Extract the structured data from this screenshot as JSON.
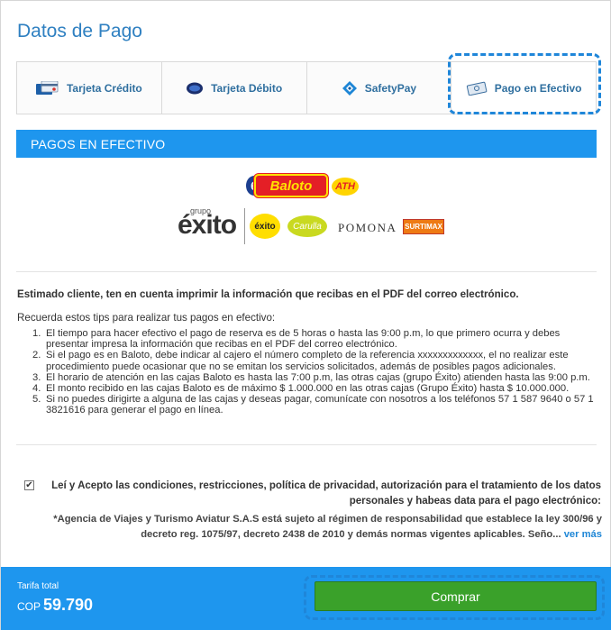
{
  "page": {
    "title": "Datos de Pago"
  },
  "tabs": [
    {
      "label": "Tarjeta Crédito",
      "icon": "credit-card-icon"
    },
    {
      "label": "Tarjeta Débito",
      "icon": "debit-card-icon"
    },
    {
      "label": "SafetyPay",
      "icon": "safetypay-icon"
    },
    {
      "label": "Pago en Efectivo",
      "icon": "cash-icon",
      "active": true
    }
  ],
  "section": {
    "heading": "PAGOS EN EFECTIVO"
  },
  "logos": {
    "baloto": "Baloto",
    "baloto_six": "6",
    "ath": "ATH",
    "grupo": "grupo",
    "exito": "éxito",
    "exito_badge": "éxito",
    "carulla": "Carulla",
    "pomona": "POMONA",
    "surtimax": "SURTIMAX"
  },
  "notice": "Estimado cliente, ten en cuenta imprimir la información que recibas en el PDF del correo electrónico.",
  "tips_intro": "Recuerda estos tips para realizar tus pagos en efectivo:",
  "tips": [
    {
      "num": "1.",
      "text": "El tiempo para hacer efectivo el pago de reserva es de 5 horas o hasta las 9:00 p.m, lo que primero ocurra y debes presentar impresa la información que recibas en el PDF del correo electrónico."
    },
    {
      "num": "2.",
      "text": "Si el pago es en Baloto, debe indicar al cajero el número completo de la referencia xxxxxxxxxxxxx, el no realizar este procedimiento puede ocasionar que no se emitan los servicios solicitados, además de posibles pagos adicionales."
    },
    {
      "num": "3.",
      "text": "El horario de atención en las cajas Baloto es hasta las 7:00 p.m, las otras cajas (grupo Éxito) atienden hasta las 9:00 p.m."
    },
    {
      "num": "4.",
      "text": "El monto recibido en las cajas Baloto es de máximo $ 1.000.000 en las otras cajas (Grupo Éxito) hasta $ 10.000.000."
    },
    {
      "num": "5.",
      "text": "Si no puedes dirigirte a alguna de las cajas y deseas pagar, comunícate con nosotros a los teléfonos 57 1 587 9640 o 57 1 3821616 para generar el pago en línea."
    }
  ],
  "terms": {
    "checked": true,
    "check_mark": "✔",
    "text": "Leí y Acepto las condiciones, restricciones, política de privacidad, autorización para el tratamiento de los datos personales y habeas data para el pago electrónico:"
  },
  "legal": {
    "text": "*Agencia de Viajes y Turismo Aviatur S.A.S está sujeto al régimen de responsabilidad que establece la ley 300/96 y decreto reg. 1075/97, decreto 2438 de 2010 y demás normas vigentes aplicables. Seño...",
    "more": "ver más"
  },
  "footer": {
    "tarifa_label": "Tarifa total",
    "currency": "COP",
    "amount": "59.790",
    "buy_label": "Comprar"
  },
  "colors": {
    "primary": "#1e96ee",
    "title": "#2f80c1",
    "buy_button": "#3aa12a",
    "highlight_dash": "#1f86d9"
  }
}
